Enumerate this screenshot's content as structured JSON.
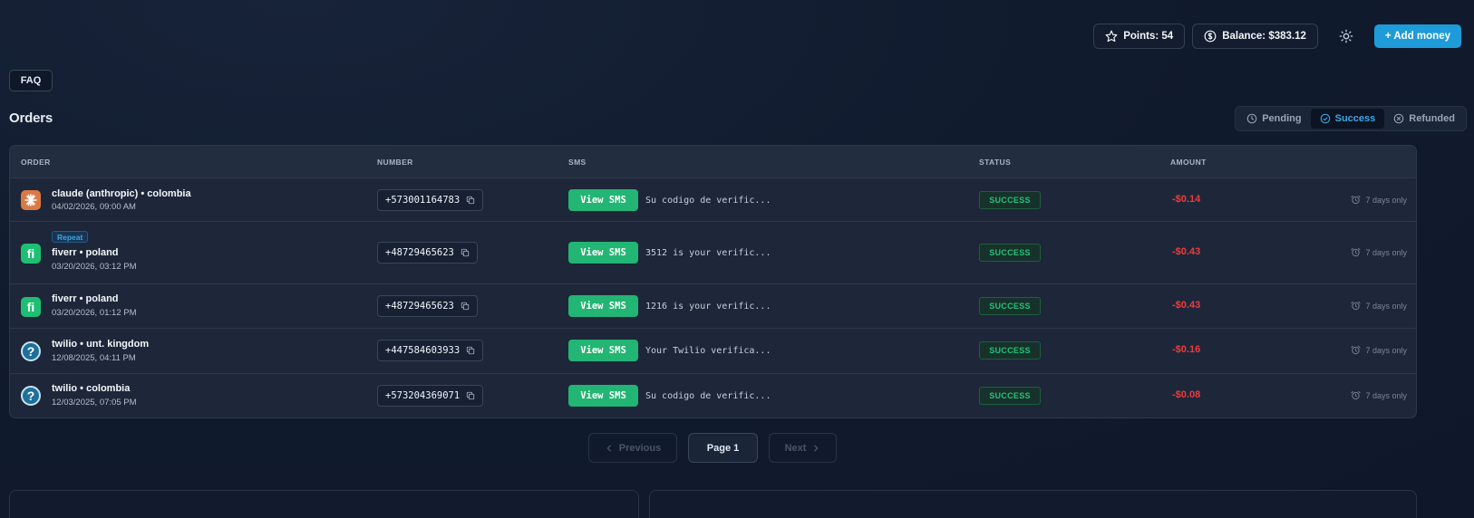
{
  "header": {
    "points_label": "Points: 54",
    "balance_label": "Balance: $383.12",
    "add_money_label": "+ Add money"
  },
  "faq_label": "FAQ",
  "orders_title": "Orders",
  "tabs": [
    {
      "label": "Pending",
      "active": false
    },
    {
      "label": "Success",
      "active": true
    },
    {
      "label": "Refunded",
      "active": false
    }
  ],
  "table": {
    "columns": [
      "ORDER",
      "NUMBER",
      "SMS",
      "STATUS",
      "AMOUNT"
    ],
    "view_sms_label": "View SMS",
    "repeat_label": "Repeat",
    "rows": [
      {
        "service": "claude (anthropic) • colombia",
        "date": "04/02/2026, 09:00 AM",
        "number": "+573001164783",
        "sms": "Su codigo de verific...",
        "status": "SUCCESS",
        "amount": "-$0.14",
        "expiry": "7 days only",
        "icon": "claude-icon",
        "repeat": false
      },
      {
        "service": "fiverr • poland",
        "date": "03/20/2026, 03:12 PM",
        "number": "+48729465623",
        "sms": "3512 is your verific...",
        "status": "SUCCESS",
        "amount": "-$0.43",
        "expiry": "7 days only",
        "icon": "fiverr-icon",
        "repeat": true
      },
      {
        "service": "fiverr • poland",
        "date": "03/20/2026, 01:12 PM",
        "number": "+48729465623",
        "sms": "1216 is your verific...",
        "status": "SUCCESS",
        "amount": "-$0.43",
        "expiry": "7 days only",
        "icon": "fiverr-icon",
        "repeat": false
      },
      {
        "service": "twilio • unt. kingdom",
        "date": "12/08/2025, 04:11 PM",
        "number": "+447584603933",
        "sms": "Your Twilio verifica...",
        "status": "SUCCESS",
        "amount": "-$0.16",
        "expiry": "7 days only",
        "icon": "twilio-icon",
        "repeat": false
      },
      {
        "service": "twilio • colombia",
        "date": "12/03/2025, 07:05 PM",
        "number": "+573204369071",
        "sms": "Su codigo de verific...",
        "status": "SUCCESS",
        "amount": "-$0.08",
        "expiry": "7 days only",
        "icon": "twilio-icon",
        "repeat": false
      }
    ]
  },
  "pagination": {
    "previous_label": "Previous",
    "page_label": "Page 1",
    "next_label": "Next"
  },
  "colors": {
    "accent": "#1e9bd9",
    "success": "#22b573",
    "negative": "#ef3b3b"
  }
}
